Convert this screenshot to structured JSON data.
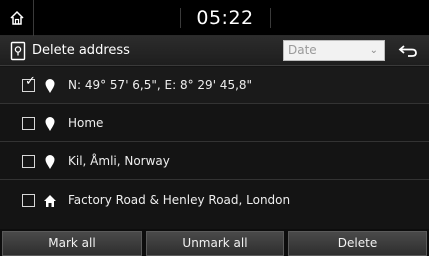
{
  "status_bar": {
    "time": "05:22",
    "home_icon": "home-icon"
  },
  "header": {
    "title": "Delete address",
    "title_icon": "address-book-icon",
    "sort": {
      "selected": "Date"
    },
    "back_icon": "back-arrow-icon"
  },
  "list": {
    "items": [
      {
        "label": "N: 49° 57' 6,5\", E: 8° 29' 45,8\"",
        "checked": true,
        "icon": "map-pin-icon"
      },
      {
        "label": "Home",
        "checked": false,
        "icon": "map-pin-icon"
      },
      {
        "label": "Kil, Åmli, Norway",
        "checked": false,
        "icon": "map-pin-icon"
      },
      {
        "label": "Factory Road & Henley Road, London",
        "checked": false,
        "icon": "house-icon"
      }
    ]
  },
  "actions": {
    "mark_all": "Mark all",
    "unmark_all": "Unmark all",
    "delete": "Delete"
  },
  "colors": {
    "background": "#141414",
    "status_bar": "#000000",
    "button": "#3a3a3a",
    "text": "#ffffff"
  }
}
